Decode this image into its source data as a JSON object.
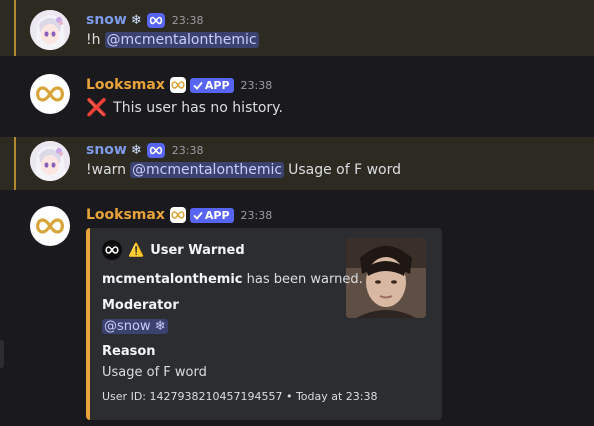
{
  "messages": [
    {
      "author": "snow",
      "role_emoji": "❄",
      "timestamp": "23:38",
      "command": "!h",
      "mention": "@mcmentalonthemic"
    },
    {
      "author": "Looksmax",
      "app_tag": "APP",
      "timestamp": "23:38",
      "text": "This user has no history."
    },
    {
      "author": "snow",
      "role_emoji": "❄",
      "timestamp": "23:38",
      "command": "!warn",
      "mention": "@mcmentalonthemic",
      "reason_text": "Usage of F word"
    },
    {
      "author": "Looksmax",
      "app_tag": "APP",
      "timestamp": "23:38"
    }
  ],
  "embed": {
    "author": "User Warned",
    "target_user": "mcmentalonthemic",
    "description_suffix": "has been warned.",
    "moderator_label": "Moderator",
    "moderator_value": "@snow ❄",
    "reason_label": "Reason",
    "reason_value": "Usage of F word",
    "footer": "User ID: 1427938210457194557 • Today at 23:38",
    "accent_color": "#e8a33a"
  },
  "colors": {
    "snow_name": "#7d9be8",
    "bot_name": "#e8a33a",
    "highlight_bg": "#2d2a22",
    "highlight_bar": "#b08a2e",
    "badge_blue": "#5865f2"
  }
}
